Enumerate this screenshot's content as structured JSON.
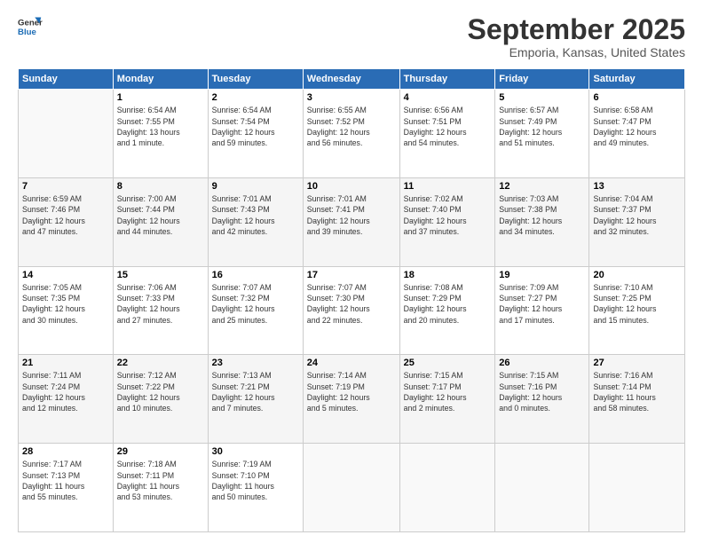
{
  "header": {
    "logo_line1": "General",
    "logo_line2": "Blue",
    "title": "September 2025",
    "subtitle": "Emporia, Kansas, United States"
  },
  "days_of_week": [
    "Sunday",
    "Monday",
    "Tuesday",
    "Wednesday",
    "Thursday",
    "Friday",
    "Saturday"
  ],
  "weeks": [
    [
      {
        "day": "",
        "info": ""
      },
      {
        "day": "1",
        "info": "Sunrise: 6:54 AM\nSunset: 7:55 PM\nDaylight: 13 hours\nand 1 minute."
      },
      {
        "day": "2",
        "info": "Sunrise: 6:54 AM\nSunset: 7:54 PM\nDaylight: 12 hours\nand 59 minutes."
      },
      {
        "day": "3",
        "info": "Sunrise: 6:55 AM\nSunset: 7:52 PM\nDaylight: 12 hours\nand 56 minutes."
      },
      {
        "day": "4",
        "info": "Sunrise: 6:56 AM\nSunset: 7:51 PM\nDaylight: 12 hours\nand 54 minutes."
      },
      {
        "day": "5",
        "info": "Sunrise: 6:57 AM\nSunset: 7:49 PM\nDaylight: 12 hours\nand 51 minutes."
      },
      {
        "day": "6",
        "info": "Sunrise: 6:58 AM\nSunset: 7:47 PM\nDaylight: 12 hours\nand 49 minutes."
      }
    ],
    [
      {
        "day": "7",
        "info": "Sunrise: 6:59 AM\nSunset: 7:46 PM\nDaylight: 12 hours\nand 47 minutes."
      },
      {
        "day": "8",
        "info": "Sunrise: 7:00 AM\nSunset: 7:44 PM\nDaylight: 12 hours\nand 44 minutes."
      },
      {
        "day": "9",
        "info": "Sunrise: 7:01 AM\nSunset: 7:43 PM\nDaylight: 12 hours\nand 42 minutes."
      },
      {
        "day": "10",
        "info": "Sunrise: 7:01 AM\nSunset: 7:41 PM\nDaylight: 12 hours\nand 39 minutes."
      },
      {
        "day": "11",
        "info": "Sunrise: 7:02 AM\nSunset: 7:40 PM\nDaylight: 12 hours\nand 37 minutes."
      },
      {
        "day": "12",
        "info": "Sunrise: 7:03 AM\nSunset: 7:38 PM\nDaylight: 12 hours\nand 34 minutes."
      },
      {
        "day": "13",
        "info": "Sunrise: 7:04 AM\nSunset: 7:37 PM\nDaylight: 12 hours\nand 32 minutes."
      }
    ],
    [
      {
        "day": "14",
        "info": "Sunrise: 7:05 AM\nSunset: 7:35 PM\nDaylight: 12 hours\nand 30 minutes."
      },
      {
        "day": "15",
        "info": "Sunrise: 7:06 AM\nSunset: 7:33 PM\nDaylight: 12 hours\nand 27 minutes."
      },
      {
        "day": "16",
        "info": "Sunrise: 7:07 AM\nSunset: 7:32 PM\nDaylight: 12 hours\nand 25 minutes."
      },
      {
        "day": "17",
        "info": "Sunrise: 7:07 AM\nSunset: 7:30 PM\nDaylight: 12 hours\nand 22 minutes."
      },
      {
        "day": "18",
        "info": "Sunrise: 7:08 AM\nSunset: 7:29 PM\nDaylight: 12 hours\nand 20 minutes."
      },
      {
        "day": "19",
        "info": "Sunrise: 7:09 AM\nSunset: 7:27 PM\nDaylight: 12 hours\nand 17 minutes."
      },
      {
        "day": "20",
        "info": "Sunrise: 7:10 AM\nSunset: 7:25 PM\nDaylight: 12 hours\nand 15 minutes."
      }
    ],
    [
      {
        "day": "21",
        "info": "Sunrise: 7:11 AM\nSunset: 7:24 PM\nDaylight: 12 hours\nand 12 minutes."
      },
      {
        "day": "22",
        "info": "Sunrise: 7:12 AM\nSunset: 7:22 PM\nDaylight: 12 hours\nand 10 minutes."
      },
      {
        "day": "23",
        "info": "Sunrise: 7:13 AM\nSunset: 7:21 PM\nDaylight: 12 hours\nand 7 minutes."
      },
      {
        "day": "24",
        "info": "Sunrise: 7:14 AM\nSunset: 7:19 PM\nDaylight: 12 hours\nand 5 minutes."
      },
      {
        "day": "25",
        "info": "Sunrise: 7:15 AM\nSunset: 7:17 PM\nDaylight: 12 hours\nand 2 minutes."
      },
      {
        "day": "26",
        "info": "Sunrise: 7:15 AM\nSunset: 7:16 PM\nDaylight: 12 hours\nand 0 minutes."
      },
      {
        "day": "27",
        "info": "Sunrise: 7:16 AM\nSunset: 7:14 PM\nDaylight: 11 hours\nand 58 minutes."
      }
    ],
    [
      {
        "day": "28",
        "info": "Sunrise: 7:17 AM\nSunset: 7:13 PM\nDaylight: 11 hours\nand 55 minutes."
      },
      {
        "day": "29",
        "info": "Sunrise: 7:18 AM\nSunset: 7:11 PM\nDaylight: 11 hours\nand 53 minutes."
      },
      {
        "day": "30",
        "info": "Sunrise: 7:19 AM\nSunset: 7:10 PM\nDaylight: 11 hours\nand 50 minutes."
      },
      {
        "day": "",
        "info": ""
      },
      {
        "day": "",
        "info": ""
      },
      {
        "day": "",
        "info": ""
      },
      {
        "day": "",
        "info": ""
      }
    ]
  ]
}
